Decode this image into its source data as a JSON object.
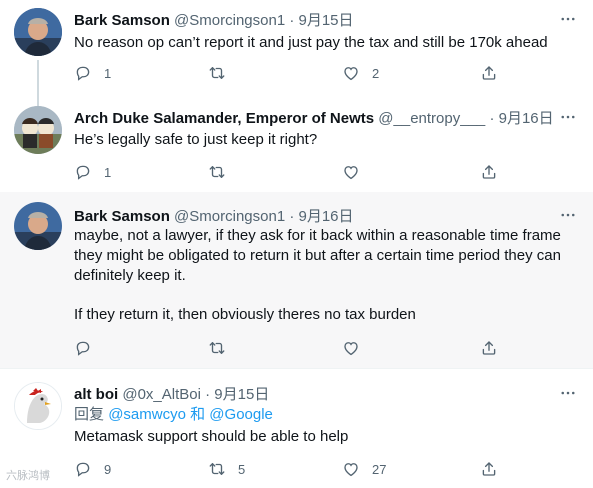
{
  "tweets": [
    {
      "name": "Bark Samson",
      "handle": "@Smorcingson1",
      "sep": "·",
      "date": "9月15日",
      "text": "No reason op can’t report it and just pay the tax and still be 170k ahead",
      "replies": "1",
      "retweets": "",
      "likes": "2"
    },
    {
      "name": "Arch Duke Salamander, Emperor of Newts",
      "handle": "@__entropy___",
      "sep": "·",
      "date": "9月16日",
      "text": "He’s legally safe to just keep it right?",
      "replies": "1",
      "retweets": "",
      "likes": ""
    },
    {
      "name": "Bark Samson",
      "handle": "@Smorcingson1",
      "sep": "·",
      "date": "9月16日",
      "text_p1": "maybe, not a lawyer, if they ask for it back within a reasonable time frame they might be obligated to return it but after a certain time period they can definitely keep it.",
      "text_p2": "If they return it, then obviously theres no tax burden",
      "replies": "",
      "retweets": "",
      "likes": ""
    },
    {
      "name": "alt boi",
      "handle": "@0x_AltBoi",
      "sep": "·",
      "date": "9月15日",
      "reply_prefix": "回复",
      "reply_user1": "@samwcyo",
      "reply_and": "和",
      "reply_user2": "@Google",
      "text": "Metamask support should be able to help",
      "replies": "9",
      "retweets": "5",
      "likes": "27"
    }
  ],
  "watermark": "六脉鸿博",
  "colors": {
    "accent": "#1d9bf0",
    "muted": "#536471",
    "highlight_bg": "#f7f7f8"
  },
  "icons": [
    "more-icon",
    "reply-icon",
    "retweet-icon",
    "like-icon",
    "share-icon"
  ]
}
